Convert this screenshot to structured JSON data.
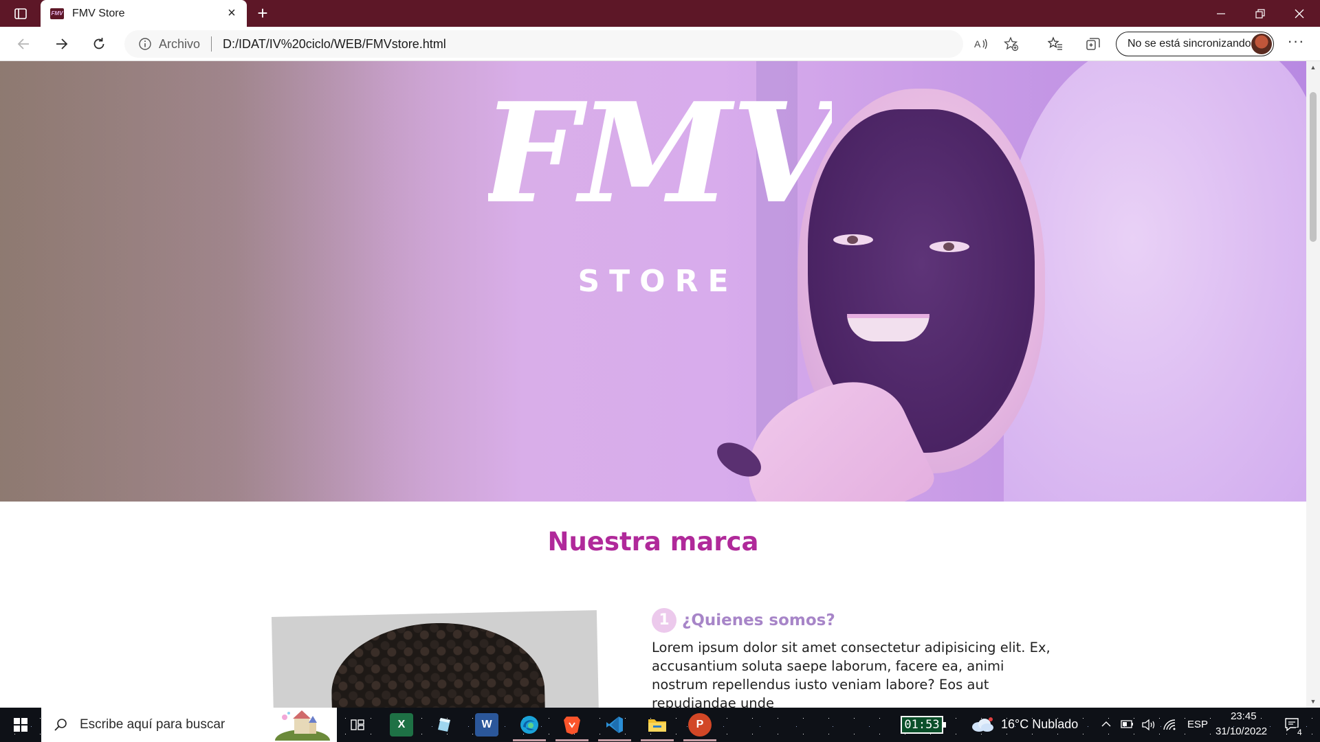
{
  "browser": {
    "tab_title": "FMV Store",
    "favicon_text": "FMV",
    "address_scheme": "Archivo",
    "address_url": "D:/IDAT/IV%20ciclo/WEB/FMVstore.html",
    "profile_label": "No se está sincronizando",
    "more_label": "···"
  },
  "hero": {
    "logo_text": "FMV",
    "subtitle": "STORE"
  },
  "section": {
    "title": "Nuestra marca",
    "step_number": "1",
    "step_heading": "¿Quienes somos?",
    "paragraph": "Lorem ipsum dolor sit amet consectetur adipisicing elit. Ex, accusantium soluta saepe laborum, facere ea, animi nostrum repellendus iusto veniam labore? Eos aut repudiandae unde"
  },
  "taskbar": {
    "search_placeholder": "Escribe aquí para buscar",
    "battery_timer": "01:53",
    "weather": "16°C  Nublado",
    "language": "ESP",
    "time": "23:45",
    "date": "31/10/2022",
    "notification_count": "4",
    "apps": [
      "task-view",
      "excel",
      "paint-3d",
      "word",
      "edge",
      "brave",
      "vscode",
      "file-explorer",
      "powerpoint"
    ]
  },
  "colors": {
    "browser_frame": "#5d1727",
    "section_title": "#b0299a",
    "step_heading": "#a785c8",
    "step_badge": "#ecc9ec"
  }
}
